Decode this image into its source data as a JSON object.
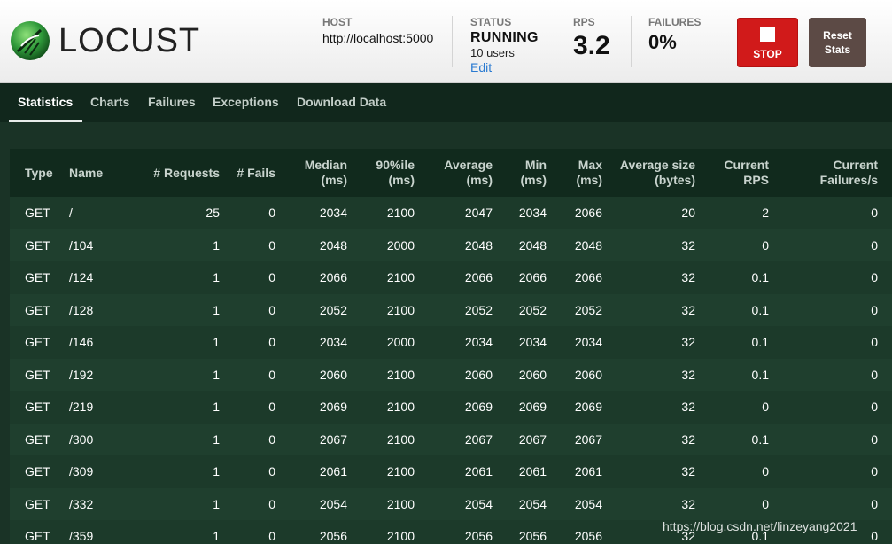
{
  "header": {
    "logo_text": "LOCUST",
    "host_label": "HOST",
    "host_value": "http://localhost:5000",
    "status_label": "STATUS",
    "status_value": "RUNNING",
    "users": "10 users",
    "edit_label": "Edit",
    "rps_label": "RPS",
    "rps_value": "3.2",
    "failures_label": "FAILURES",
    "failures_value": "0%",
    "stop_label": "STOP",
    "reset_label_line1": "Reset",
    "reset_label_line2": "Stats"
  },
  "tabs": [
    {
      "label": "Statistics",
      "active": true
    },
    {
      "label": "Charts",
      "active": false
    },
    {
      "label": "Failures",
      "active": false
    },
    {
      "label": "Exceptions",
      "active": false
    },
    {
      "label": "Download Data",
      "active": false
    }
  ],
  "table": {
    "columns": [
      {
        "line1": "Type",
        "line2": ""
      },
      {
        "line1": "Name",
        "line2": ""
      },
      {
        "line1": "# Requests",
        "line2": ""
      },
      {
        "line1": "# Fails",
        "line2": ""
      },
      {
        "line1": "Median",
        "line2": "(ms)"
      },
      {
        "line1": "90%ile",
        "line2": "(ms)"
      },
      {
        "line1": "Average",
        "line2": "(ms)"
      },
      {
        "line1": "Min",
        "line2": "(ms)"
      },
      {
        "line1": "Max",
        "line2": "(ms)"
      },
      {
        "line1": "Average size",
        "line2": "(bytes)"
      },
      {
        "line1": "Current",
        "line2": "RPS"
      },
      {
        "line1": "Current",
        "line2": "Failures/s"
      }
    ],
    "rows": [
      [
        "GET",
        "/",
        "25",
        "0",
        "2034",
        "2100",
        "2047",
        "2034",
        "2066",
        "20",
        "2",
        "0"
      ],
      [
        "GET",
        "/104",
        "1",
        "0",
        "2048",
        "2000",
        "2048",
        "2048",
        "2048",
        "32",
        "0",
        "0"
      ],
      [
        "GET",
        "/124",
        "1",
        "0",
        "2066",
        "2100",
        "2066",
        "2066",
        "2066",
        "32",
        "0.1",
        "0"
      ],
      [
        "GET",
        "/128",
        "1",
        "0",
        "2052",
        "2100",
        "2052",
        "2052",
        "2052",
        "32",
        "0.1",
        "0"
      ],
      [
        "GET",
        "/146",
        "1",
        "0",
        "2034",
        "2000",
        "2034",
        "2034",
        "2034",
        "32",
        "0.1",
        "0"
      ],
      [
        "GET",
        "/192",
        "1",
        "0",
        "2060",
        "2100",
        "2060",
        "2060",
        "2060",
        "32",
        "0.1",
        "0"
      ],
      [
        "GET",
        "/219",
        "1",
        "0",
        "2069",
        "2100",
        "2069",
        "2069",
        "2069",
        "32",
        "0",
        "0"
      ],
      [
        "GET",
        "/300",
        "1",
        "0",
        "2067",
        "2100",
        "2067",
        "2067",
        "2067",
        "32",
        "0.1",
        "0"
      ],
      [
        "GET",
        "/309",
        "1",
        "0",
        "2061",
        "2100",
        "2061",
        "2061",
        "2061",
        "32",
        "0",
        "0"
      ],
      [
        "GET",
        "/332",
        "1",
        "0",
        "2054",
        "2100",
        "2054",
        "2054",
        "2054",
        "32",
        "0",
        "0"
      ],
      [
        "GET",
        "/359",
        "1",
        "0",
        "2056",
        "2100",
        "2056",
        "2056",
        "2056",
        "32",
        "0.1",
        "0"
      ]
    ]
  },
  "watermark": "https://blog.csdn.net/linzeyang2021",
  "colors": {
    "background": "#1a3326",
    "nav": "#11271c",
    "stop_button": "#d11a1a",
    "reset_button": "#5c4a45",
    "edit_link": "#2b7bd1"
  }
}
